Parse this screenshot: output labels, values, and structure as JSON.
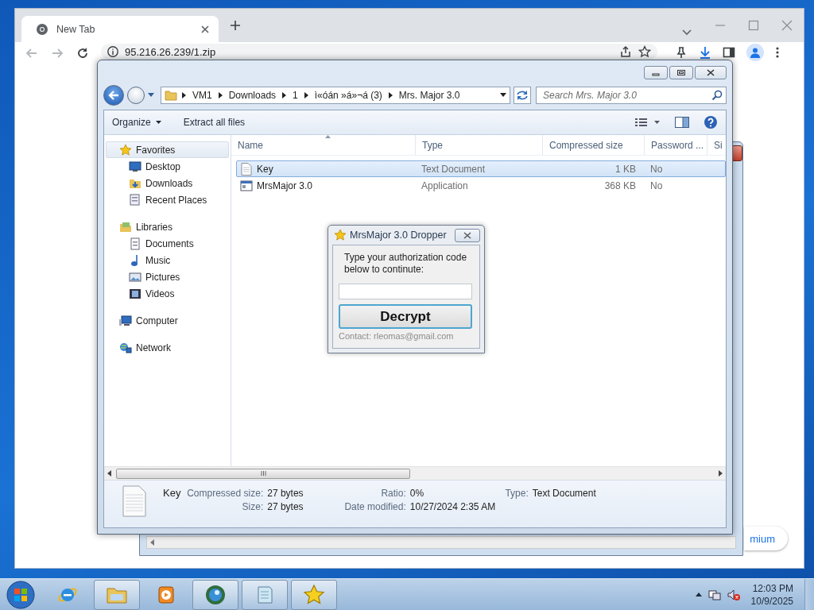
{
  "browser": {
    "tab": {
      "title": "New Tab",
      "selected": true
    },
    "address": "95.216.26.239/1.zip",
    "page_button": "mium"
  },
  "explorer": {
    "breadcrumb": [
      "VM1",
      "Downloads",
      "1",
      "ì«óán »á»¬á (3)",
      "Mrs. Major 3.0"
    ],
    "search": {
      "placeholder": "Search Mrs. Major 3.0"
    },
    "commands": [
      "Organize",
      "Extract all files"
    ],
    "nav": [
      {
        "label": "Favorites",
        "kind": "star",
        "selected": true,
        "children": [
          {
            "label": "Desktop",
            "kind": "desktop",
            "selected": false
          },
          {
            "label": "Downloads",
            "kind": "downloads",
            "selected": false
          },
          {
            "label": "Recent Places",
            "kind": "recent",
            "selected": false
          }
        ]
      },
      {
        "label": "Libraries",
        "kind": "libraries",
        "selected": false,
        "children": [
          {
            "label": "Documents",
            "kind": "documents",
            "selected": false
          },
          {
            "label": "Music",
            "kind": "music",
            "selected": false
          },
          {
            "label": "Pictures",
            "kind": "pictures",
            "selected": false
          },
          {
            "label": "Videos",
            "kind": "videos",
            "selected": false
          }
        ]
      },
      {
        "label": "Computer",
        "kind": "computer",
        "selected": false
      },
      {
        "label": "Network",
        "kind": "network",
        "selected": false
      }
    ],
    "columns": [
      "Name",
      "Type",
      "Compressed size",
      "Password ...",
      "Si"
    ],
    "rows": [
      {
        "name": "Key",
        "kind": "text",
        "type": "Text Document",
        "compressed_size": "1 KB",
        "password": "No",
        "selected": true
      },
      {
        "name": "MrsMajor 3.0",
        "kind": "app",
        "type": "Application",
        "compressed_size": "368 KB",
        "password": "No",
        "selected": false
      }
    ],
    "details": {
      "name": "Key",
      "fields": [
        {
          "label": "Compressed size:",
          "value": "27 bytes"
        },
        {
          "label": "Size:",
          "value": "27 bytes"
        },
        {
          "label": "Ratio:",
          "value": "0%"
        },
        {
          "label": "Date modified:",
          "value": "10/27/2024 2:35 AM"
        },
        {
          "label": "Type:",
          "value": "Text Document"
        }
      ]
    }
  },
  "dialog": {
    "title": "MrsMajor 3.0 Dropper",
    "prompt": "Type your authorization code below to continute:",
    "button": "Decrypt",
    "contact": "Contact: rleomas@gmail.com"
  },
  "taskbar": {
    "apps": [
      {
        "kind": "ie",
        "open": false
      },
      {
        "kind": "folder",
        "open": true
      },
      {
        "kind": "media",
        "open": false
      },
      {
        "kind": "globe",
        "open": true
      },
      {
        "kind": "notepad",
        "open": true
      },
      {
        "kind": "star",
        "open": true
      }
    ],
    "clock": {
      "time": "12:03 PM",
      "date": "10/9/2025"
    }
  }
}
